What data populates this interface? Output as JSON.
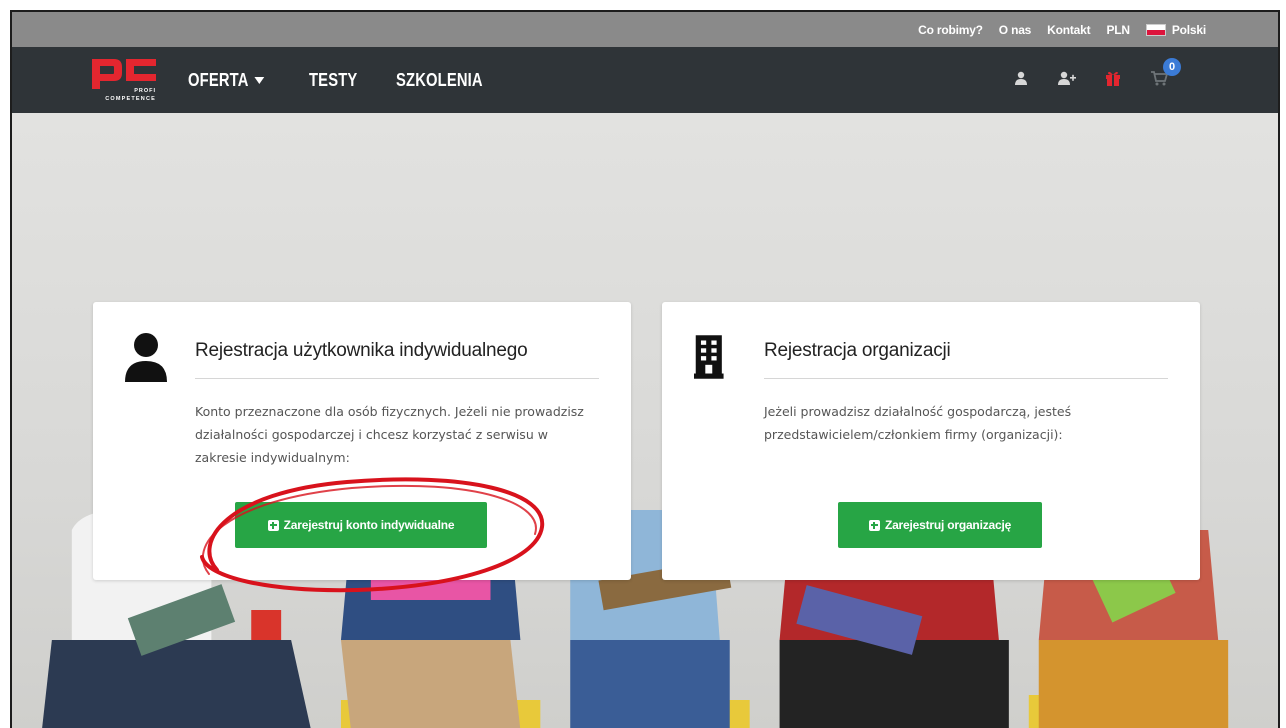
{
  "topbar": {
    "links": [
      "Co robimy?",
      "O nas",
      "Kontakt",
      "PLN"
    ],
    "language": "Polski"
  },
  "nav": {
    "logo_text": "PROFI COMPETENCE",
    "items": {
      "oferta": "OFERTA",
      "testy": "TESTY",
      "szkolenia": "SZKOLENIA"
    },
    "icons": [
      "user-icon",
      "user-plus-icon",
      "gift-icon",
      "cart-icon"
    ],
    "cart_count": "0"
  },
  "cards": {
    "individual": {
      "title": "Rejestracja użytkownika indywidualnego",
      "description": "Konto przeznaczone dla osób fizycznych. Jeżeli nie prowadzisz działalności gospodarczej i chcesz korzystać z serwisu w zakresie indywidualnym:",
      "button_label": "Zarejestruj konto indywidualne",
      "icon": "user-icon"
    },
    "organization": {
      "title": "Rejestracja organizacji",
      "description": "Jeżeli prowadzisz działalność gospodarczą, jesteś przedstawicielem/członkiem firmy (organizacji):",
      "button_label": "Zarejestruj organizację",
      "icon": "building-icon"
    }
  },
  "colors": {
    "accent_green": "#27a545",
    "nav_bg": "#2f3438",
    "topbar_bg": "#8a8a8a",
    "logo_red": "#e3262f",
    "badge_blue": "#3b7bd6",
    "highlight_red": "#d8121c"
  }
}
